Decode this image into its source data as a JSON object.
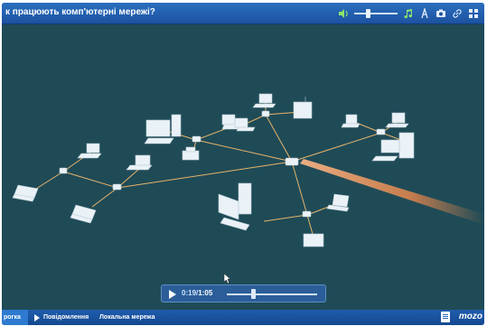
{
  "window": {
    "title": "к працюють комп'ютерні мережі?"
  },
  "toolbar": {
    "icons": [
      "volume-icon",
      "volume-slider",
      "music-icon",
      "text-icon",
      "camera-icon",
      "link-icon",
      "grid-icon"
    ],
    "volume_level": 0.3
  },
  "player": {
    "current_time": "0:19",
    "separator": "/",
    "total_time": "1:05",
    "progress": 0.29
  },
  "tabs": [
    {
      "label": "рогка",
      "active": true
    },
    {
      "label": "Повідомлення",
      "active": false
    },
    {
      "label": "Локальна мережа",
      "active": false
    }
  ],
  "brand": {
    "label": "mozo"
  },
  "colors": {
    "titlebar": "#1d52a0",
    "stage_bg": "#1f4b57",
    "cable": "#e7b36a",
    "signal": "#f08a4b",
    "device": "#eaf2f7"
  }
}
